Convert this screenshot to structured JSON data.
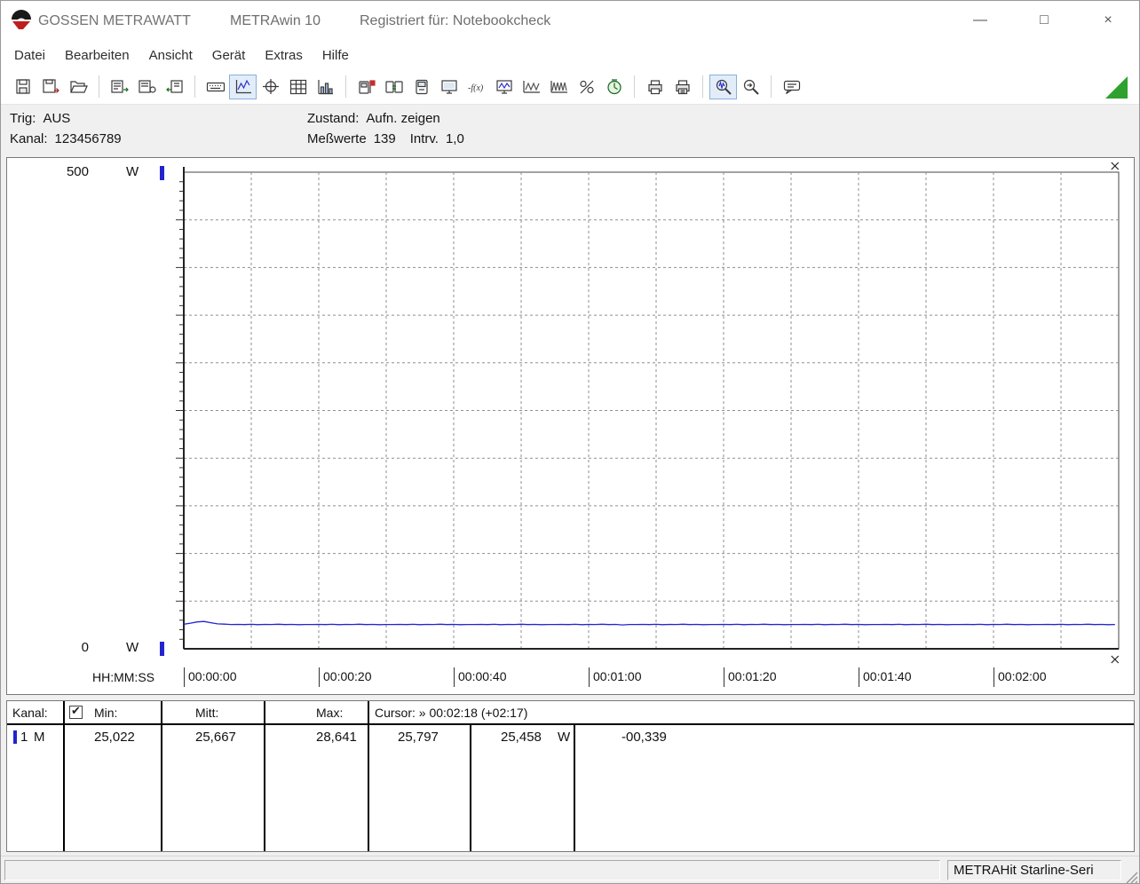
{
  "window": {
    "vendor": "GOSSEN METRAWATT",
    "app": "METRAwin 10",
    "registered": "Registriert für: Notebookcheck",
    "minimize_glyph": "—",
    "maximize_glyph": "□",
    "close_glyph": "×"
  },
  "menu": {
    "items": [
      {
        "label": "Datei",
        "name": "menu-item-datei"
      },
      {
        "label": "Bearbeiten",
        "name": "menu-item-bearbeiten"
      },
      {
        "label": "Ansicht",
        "name": "menu-item-ansicht"
      },
      {
        "label": "Gerät",
        "name": "menu-item-geraet"
      },
      {
        "label": "Extras",
        "name": "menu-item-extras"
      },
      {
        "label": "Hilfe",
        "name": "menu-item-hilfe"
      }
    ]
  },
  "toolbar": {
    "status_triangle_color": "#2ea12e",
    "buttons": [
      {
        "name": "save",
        "icon": "save"
      },
      {
        "name": "save-as",
        "icon": "save-as"
      },
      {
        "name": "open",
        "icon": "open"
      },
      {
        "separator": true
      },
      {
        "name": "export-data",
        "icon": "export-1"
      },
      {
        "name": "export-snapshot",
        "icon": "export-2"
      },
      {
        "name": "import-data",
        "icon": "export-3"
      },
      {
        "separator": true
      },
      {
        "name": "keyboard-entry",
        "icon": "keyboard"
      },
      {
        "name": "view-line-chart",
        "icon": "chart-line",
        "active": true
      },
      {
        "name": "view-xy-chart",
        "icon": "chart-crosshair"
      },
      {
        "name": "view-table",
        "icon": "table-view"
      },
      {
        "name": "view-histogram",
        "icon": "chart-bar"
      },
      {
        "separator": true
      },
      {
        "name": "device-setup",
        "icon": "device-flag"
      },
      {
        "name": "device-transfer",
        "icon": "device-transfer"
      },
      {
        "name": "device-display",
        "icon": "device-screen"
      },
      {
        "name": "online-monitor",
        "icon": "monitor"
      },
      {
        "name": "formula",
        "icon": "formula"
      },
      {
        "name": "online-wave",
        "icon": "monitor-wave"
      },
      {
        "name": "signal-pair",
        "icon": "wave-pair"
      },
      {
        "name": "signal-dense",
        "icon": "wave-dense"
      },
      {
        "name": "scaling-percent",
        "icon": "percent"
      },
      {
        "name": "timer",
        "icon": "timer"
      },
      {
        "separator": true
      },
      {
        "name": "print",
        "icon": "print"
      },
      {
        "name": "print-preview",
        "icon": "print-preview"
      },
      {
        "separator": true
      },
      {
        "name": "zoom-signal",
        "icon": "zoom-wave",
        "active": true
      },
      {
        "name": "zoom-mode",
        "icon": "zoom-mode"
      },
      {
        "separator": true
      },
      {
        "name": "annotation",
        "icon": "note"
      }
    ]
  },
  "status_panel": {
    "trig_label": "Trig:",
    "trig_value": "AUS",
    "kanal_label": "Kanal:",
    "kanal_value": "123456789",
    "zustand_label": "Zustand:",
    "zustand_value": "Aufn. zeigen",
    "messwerte_label": "Meßwerte",
    "messwerte_value": "139",
    "intrv_label": "Intrv.",
    "intrv_value": "1,0"
  },
  "chart_labels": {
    "y_max": "500",
    "y_min": "0",
    "y_unit_top": "W",
    "y_unit_bottom": "W"
  },
  "chart_data": {
    "type": "line",
    "title": "",
    "xlabel": "HH:MM:SS",
    "ylabel": "W",
    "ylim": [
      0,
      500
    ],
    "grid": true,
    "legend": false,
    "y_gridline_step": 50,
    "x_gridline_step_seconds": 10,
    "x_tick_step_seconds": 20,
    "x_ticks": [
      "00:00:00",
      "00:00:20",
      "00:00:40",
      "00:01:00",
      "00:01:20",
      "00:01:40",
      "00:02:00"
    ],
    "sample_interval_seconds": 1.0,
    "cursor_time_seconds": 138,
    "series": [
      {
        "name": "Kanal 1",
        "unit": "W",
        "color": "#2323cf",
        "min": 25.022,
        "mean": 25.667,
        "max": 28.641,
        "values": [
          25.8,
          26.9,
          28.2,
          28.641,
          27.4,
          26.2,
          25.9,
          25.5,
          25.65,
          25.45,
          25.7,
          25.35,
          25.6,
          25.5,
          25.75,
          25.4,
          25.6,
          25.3,
          25.55,
          25.5,
          25.65,
          25.45,
          25.7,
          25.35,
          25.6,
          25.5,
          25.75,
          25.4,
          25.6,
          25.3,
          25.55,
          25.5,
          25.65,
          25.45,
          25.7,
          25.35,
          25.6,
          25.5,
          25.75,
          25.4,
          25.6,
          25.3,
          25.55,
          25.5,
          25.65,
          25.45,
          25.7,
          25.35,
          25.6,
          25.5,
          25.75,
          25.4,
          25.6,
          25.3,
          25.55,
          25.5,
          25.65,
          25.45,
          25.7,
          25.35,
          25.6,
          25.5,
          25.75,
          25.4,
          25.6,
          25.022,
          25.55,
          25.5,
          25.65,
          25.45,
          25.7,
          25.35,
          25.6,
          25.5,
          25.75,
          25.4,
          25.6,
          25.3,
          25.55,
          25.5,
          25.65,
          25.45,
          25.7,
          25.35,
          25.6,
          25.5,
          25.75,
          25.4,
          25.6,
          25.3,
          25.55,
          25.5,
          25.65,
          25.45,
          25.7,
          25.35,
          25.6,
          25.5,
          25.75,
          25.4,
          25.6,
          25.3,
          25.55,
          25.5,
          25.65,
          25.45,
          25.7,
          25.35,
          25.6,
          25.5,
          25.75,
          25.4,
          25.6,
          25.3,
          25.55,
          25.5,
          25.65,
          25.45,
          25.7,
          25.35,
          25.6,
          25.5,
          25.75,
          25.4,
          25.6,
          25.3,
          25.55,
          25.5,
          25.65,
          25.45,
          25.7,
          25.35,
          25.6,
          25.5,
          25.75,
          25.4,
          25.6,
          25.3,
          25.55
        ]
      }
    ]
  },
  "table": {
    "headers": {
      "kanal": "Kanal:",
      "min": "Min:",
      "mitt": "Mitt:",
      "max": "Max:",
      "cursor": "Cursor: » 00:02:18 (+02:17)"
    },
    "checkbox_mark": "✔",
    "row": {
      "channel": "1",
      "mode": "M",
      "min": "25,022",
      "mitt": "25,667",
      "max": "28,641",
      "cursor_left": "25,797",
      "cursor_right": "25,458",
      "unit": "W",
      "delta": "-00,339"
    }
  },
  "statusbar": {
    "device_label": "METRAHit Starline-Seri"
  }
}
